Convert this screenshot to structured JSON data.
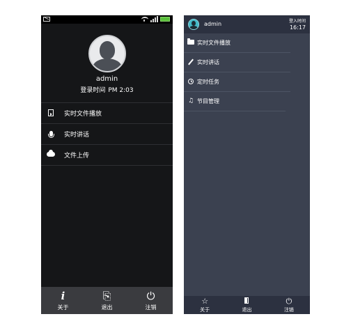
{
  "left_screen": {
    "user": {
      "name": "admin",
      "login_label": "登录时间",
      "login_time": "PM  2:03"
    },
    "menu": [
      {
        "label": "实时文件播放",
        "icon": "file-play-icon"
      },
      {
        "label": "实时讲话",
        "icon": "microphone-icon"
      },
      {
        "label": "文件上传",
        "icon": "cloud-upload-icon"
      }
    ],
    "bottom_tabs": [
      {
        "label": "关于",
        "icon": "info-icon",
        "glyph": "i"
      },
      {
        "label": "退出",
        "icon": "exit-icon",
        "glyph": "⎘"
      },
      {
        "label": "注销",
        "icon": "power-icon",
        "glyph": "⏻"
      }
    ],
    "colors": {
      "background": "#151618",
      "bottom_bar": "#3a3b3f",
      "battery": "#59c03a"
    }
  },
  "right_screen": {
    "header": {
      "user": "admin",
      "login_label": "登入时间",
      "login_time": "16:17"
    },
    "menu": [
      {
        "label": "实时文件播放",
        "icon": "folder-icon"
      },
      {
        "label": "实时讲话",
        "icon": "pen-icon"
      },
      {
        "label": "定时任务",
        "icon": "clock-icon"
      },
      {
        "label": "节目管理",
        "icon": "music-icon"
      }
    ],
    "bottom_tabs": [
      {
        "label": "关于",
        "icon": "star-icon",
        "glyph": "☆"
      },
      {
        "label": "退出",
        "icon": "door-icon"
      },
      {
        "label": "注销",
        "icon": "power-icon",
        "glyph": "⏻"
      }
    ],
    "colors": {
      "background": "#3b4150",
      "header": "#2c3140",
      "avatar": "#42b9c8"
    }
  }
}
